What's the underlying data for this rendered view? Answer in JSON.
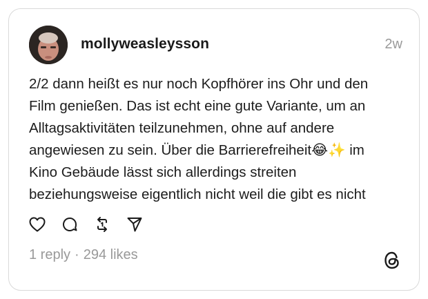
{
  "post": {
    "username": "mollyweasleysson",
    "time_ago": "2w",
    "text": "2/2 dann heißt es nur noch Kopfhörer ins Ohr und den\nFilm genießen. Das ist echt eine gute Variante, um an\nAlltagsaktivitäten teilzunehmen, ohne auf andere\nangewiesen zu sein. Über die Barrierefreiheit😂✨ im\nKino Gebäude lässt sich allerdings streiten\nbeziehungsweise eigentlich nicht weil die gibt es nicht",
    "replies": "1 reply",
    "separator": "·",
    "likes": "294 likes"
  },
  "icons": {
    "like": "heart-icon",
    "reply": "comment-bubble-icon",
    "repost": "repost-icon",
    "share": "send-icon",
    "brand": "threads-logo-icon"
  },
  "colors": {
    "text": "#1c1c1c",
    "muted": "#999999",
    "border": "#d9d9d9"
  }
}
